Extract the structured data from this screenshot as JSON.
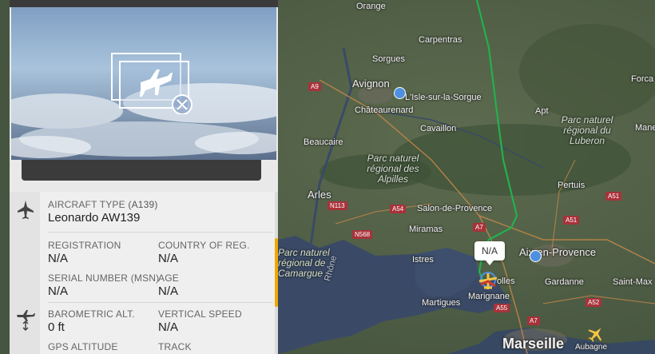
{
  "map": {
    "places": [
      {
        "id": "orange",
        "label": "Orange"
      },
      {
        "id": "carpentras",
        "label": "Carpentras"
      },
      {
        "id": "sorgues",
        "label": "Sorgues"
      },
      {
        "id": "avignon",
        "label": "Avignon"
      },
      {
        "id": "lisle",
        "label": "L'Isle-sur-la-Sorgue"
      },
      {
        "id": "chateaurenard",
        "label": "Châteaurenard"
      },
      {
        "id": "cavaillon",
        "label": "Cavaillon"
      },
      {
        "id": "beaucaire",
        "label": "Beaucaire"
      },
      {
        "id": "arles",
        "label": "Arles"
      },
      {
        "id": "salon",
        "label": "Salon-de-Provence"
      },
      {
        "id": "miramas",
        "label": "Miramas"
      },
      {
        "id": "istres",
        "label": "Istres"
      },
      {
        "id": "martigues",
        "label": "Martigues"
      },
      {
        "id": "marignane",
        "label": "Marignane"
      },
      {
        "id": "vitrolles",
        "label": "olles"
      },
      {
        "id": "aix",
        "label": "Aix-en-Provence"
      },
      {
        "id": "gardanne",
        "label": "Gardanne"
      },
      {
        "id": "saintmax",
        "label": "Saint-Max"
      },
      {
        "id": "marseille",
        "label": "Marseille"
      },
      {
        "id": "aubagne",
        "label": "Aubagne"
      },
      {
        "id": "apt",
        "label": "Apt"
      },
      {
        "id": "pertuis",
        "label": "Pertuis"
      },
      {
        "id": "forca",
        "label": "Forca"
      },
      {
        "id": "mane",
        "label": "Mane"
      },
      {
        "id": "rhone",
        "label": "Rhône"
      }
    ],
    "parks": [
      {
        "id": "alpilles",
        "label": "Parc naturel régional des Alpilles"
      },
      {
        "id": "luberon",
        "label": "Parc naturel régional du Luberon"
      },
      {
        "id": "camargue",
        "label": "Parc naturel régional de Camargue"
      }
    ],
    "roads": [
      "A9",
      "N113",
      "N568",
      "A54",
      "A7",
      "A51",
      "A51",
      "A55",
      "A52",
      "A7"
    ],
    "flight_callout": "N/A",
    "colors": {
      "track": "#22b14c",
      "aircraft": "#f5c542",
      "water": "#3a4a66",
      "land": "#4f5e46"
    }
  },
  "panel": {
    "aircraft_type_label": "AIRCRAFT TYPE",
    "aircraft_type_code": "(A139)",
    "aircraft_type_value": "Leonardo AW139",
    "registration_label": "REGISTRATION",
    "registration_value": "N/A",
    "country_label": "COUNTRY OF REG.",
    "country_value": "N/A",
    "serial_label": "SERIAL NUMBER (MSN)",
    "serial_value": "N/A",
    "age_label": "AGE",
    "age_value": "N/A",
    "baro_label": "BAROMETRIC ALT.",
    "baro_value": "0 ft",
    "vspeed_label": "VERTICAL SPEED",
    "vspeed_value": "N/A",
    "gps_label": "GPS ALTITUDE",
    "track_label": "TRACK"
  }
}
